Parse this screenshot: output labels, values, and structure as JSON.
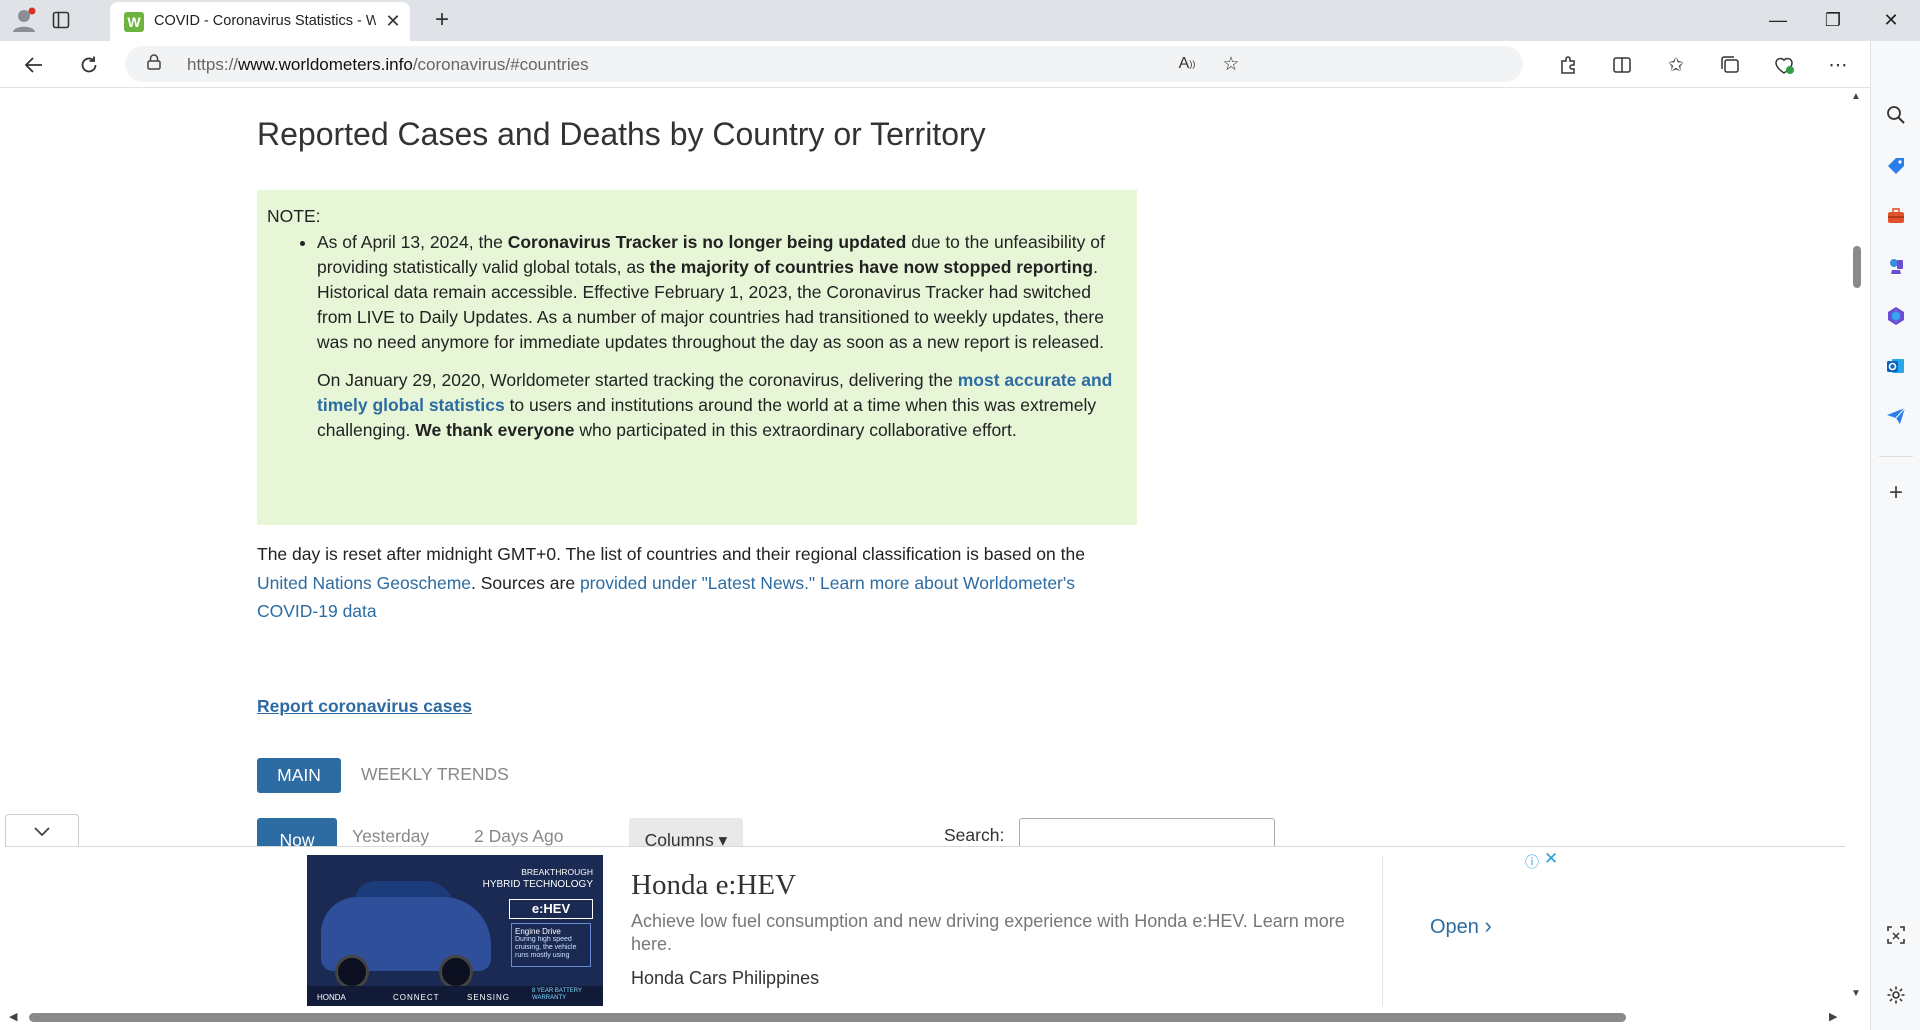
{
  "browser": {
    "tab_title": "COVID - Coronavirus Statistics - W",
    "tab_favicon_letter": "W",
    "url_prefix": "https://",
    "url_domain": "www.worldometers.info",
    "url_path": "/coronavirus/#countries",
    "colors": {
      "tabstrip": "#dfe3e8",
      "accent": "#2d6ca2"
    }
  },
  "page": {
    "title": "Reported Cases and Deaths by Country or Territory",
    "note": {
      "label": "NOTE:",
      "p1_a": "As of April 13, 2024, the ",
      "p1_b": "Coronavirus Tracker is no longer being updated",
      "p1_c": " due to the unfeasibility of providing statistically valid global totals, as ",
      "p1_d": "the majority of countries have now stopped reporting",
      "p1_e": ". Historical data remain accessible. Effective February 1, 2023, the Coronavirus Tracker had switched from LIVE to Daily Updates. As a number of major countries had transitioned to weekly updates, there was no need anymore for immediate updates throughout the day as soon as a new report is released.",
      "p2_a": "On January 29, 2020, Worldometer started tracking the coronavirus, delivering the ",
      "p2_link": "most accurate and timely global statistics",
      "p2_b": " to users and institutions around the world at a time when this was extremely challenging. ",
      "p2_c": "We thank everyone",
      "p2_d": " who participated in this extraordinary collaborative effort."
    },
    "day_text_a": "The day is reset after midnight GMT+0. The list of countries and their regional classification is based on the ",
    "day_link_1": "United Nations Geoscheme",
    "day_text_b": ". Sources are ",
    "day_link_2": "provided under \"Latest News.\"",
    "day_text_c": " ",
    "day_link_3": "Learn more about Worldometer's COVID-19 data",
    "report_link": "Report coronavirus cases",
    "tabs": {
      "main": "MAIN",
      "weekly": "WEEKLY TRENDS"
    },
    "day_tabs": {
      "now": "Now",
      "yesterday": "Yesterday",
      "two_days": "2 Days Ago",
      "columns": "Columns ▾"
    },
    "search_label": "Search:",
    "search_value": ""
  },
  "ad": {
    "title": "Honda e:HEV",
    "description": "Achieve low fuel consumption and new driving experience with Honda e:HEV. Learn more here.",
    "brand": "Honda Cars Philippines",
    "open_label": "Open",
    "image": {
      "line1": "BREAKTHROUGH",
      "line2": "HYBRID TECHNOLOGY",
      "badge": "e:HEV",
      "panel_title": "Engine Drive",
      "panel_text": "During high speed cruising, the vehicle runs mostly using engine for a more sustained high speed driving.",
      "bottom_brand": "HONDA",
      "bottom_connect": "CONNECT",
      "bottom_sensing": "SENSING",
      "bottom_warranty": "8 YEAR BATTERY WARRANTY"
    }
  }
}
